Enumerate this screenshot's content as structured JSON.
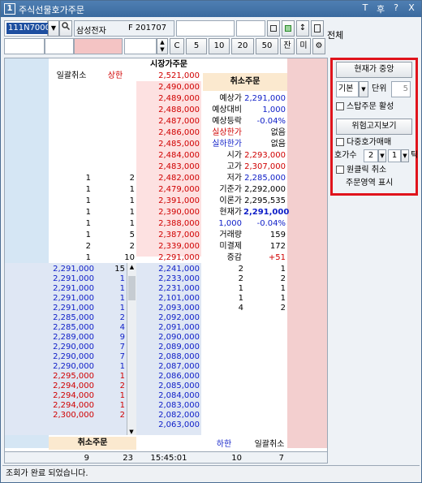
{
  "window": {
    "title": "주식선물호가주문",
    "title_icon": "1",
    "buttons": [
      "T",
      "후",
      "?",
      "X"
    ]
  },
  "toolbar": {
    "code": "111N7000",
    "name": "삼성전자",
    "contract": "F 201707",
    "full_label": "전체",
    "qty_buttons": [
      "C",
      "5",
      "10",
      "20",
      "50",
      "잔",
      "미"
    ]
  },
  "grid": {
    "header_market_order": "시장가주문",
    "left_cancel_all": "일괄취소",
    "left_upper_limit": "상한",
    "cancel_order_label": "취소주문",
    "bottom_cancel_order": "취소주문",
    "bottom_lower_limit": "하한",
    "bottom_cancel_all": "일괄취소",
    "ask_prices": [
      "2,521,000",
      "2,490,000",
      "2,489,000",
      "2,488,000",
      "2,487,000",
      "2,486,000",
      "2,485,000",
      "2,484,000",
      "2,483,000",
      "2,482,000",
      "2,479,000",
      "2,391,000",
      "2,390,000",
      "2,388,000",
      "2,387,000",
      "2,339,000",
      "2,291,000"
    ],
    "ask_left_qty": [
      "",
      "",
      "",
      "",
      "",
      "",
      "",
      "",
      "",
      "1",
      "1",
      "1",
      "1",
      "1",
      "1",
      "2",
      "1"
    ],
    "ask_right_qty": [
      "",
      "",
      "",
      "",
      "",
      "",
      "",
      "",
      "",
      "2",
      "1",
      "1",
      "1",
      "1",
      "5",
      "2",
      "10"
    ],
    "info": [
      {
        "label": "예상가",
        "value": "2,291,000"
      },
      {
        "label": "예상대비",
        "value": "1,000"
      },
      {
        "label": "예상등락",
        "value": "-0.04%"
      },
      {
        "label": "실상한가",
        "value": "없음"
      },
      {
        "label": "실하한가",
        "value": "없음"
      },
      {
        "label": "시가",
        "value": "2,293,000"
      },
      {
        "label": "고가",
        "value": "2,307,000"
      },
      {
        "label": "저가",
        "value": "2,285,000"
      },
      {
        "label": "기준가",
        "value": "2,292,000"
      },
      {
        "label": "이론가",
        "value": "2,295,535"
      },
      {
        "label": "현재가",
        "value": "2,291,000"
      },
      {
        "label": "1,000",
        "value": "-0.04%"
      },
      {
        "label": "거래량",
        "value": "159"
      },
      {
        "label": "미결제",
        "value": "172"
      },
      {
        "label": "증감",
        "value": "+51"
      }
    ],
    "bid_prices": [
      "2,241,000",
      "2,233,000",
      "2,231,000",
      "2,101,000",
      "2,093,000",
      "2,092,000",
      "2,091,000",
      "2,090,000",
      "2,089,000",
      "2,088,000",
      "2,087,000",
      "2,086,000",
      "2,085,000",
      "2,084,000",
      "2,083,000",
      "2,082,000",
      "2,063,000"
    ],
    "bid_right_qty": [
      "2",
      "2",
      "1",
      "1",
      "4",
      "",
      "",
      "",
      "",
      "",
      "",
      "",
      "",
      "",
      "",
      "",
      ""
    ],
    "bid_right2_qty": [
      "1",
      "2",
      "1",
      "1",
      "2",
      "",
      "",
      "",
      "",
      "",
      "",
      "",
      "",
      "",
      "",
      "",
      ""
    ],
    "sell_prices": [
      "2,291,000",
      "2,291,000",
      "2,291,000",
      "2,291,000",
      "2,291,000",
      "2,285,000",
      "2,285,000",
      "2,289,000",
      "2,290,000",
      "2,290,000",
      "2,290,000",
      "2,295,000",
      "2,294,000",
      "2,294,000",
      "2,294,000",
      "2,300,000"
    ],
    "sell_qty": [
      "15",
      "1",
      "1",
      "1",
      "1",
      "2",
      "4",
      "9",
      "7",
      "7",
      "1",
      "1",
      "2",
      "1",
      "1",
      "2"
    ],
    "footer": {
      "left_total": "9",
      "mid_total": "23",
      "time": "15:45:01",
      "right_total1": "10",
      "right_total2": "7"
    }
  },
  "side_panel": {
    "current_center": "현재가 중앙",
    "base_select": "기본",
    "unit_label": "단위",
    "unit_value": "5",
    "stop_order": "스탑주문 활성",
    "risk_notice": "위험고지보기",
    "multi_order": "다중호가매매",
    "hoga_label": "호가수",
    "hoga_value1": "2",
    "hoga_value2": "1",
    "tick_label": "틱",
    "one_click_cancel": "원클릭 취소",
    "order_area_show": "주문영역 표시"
  },
  "status": {
    "message": "조회가 완료 되었습니다."
  }
}
